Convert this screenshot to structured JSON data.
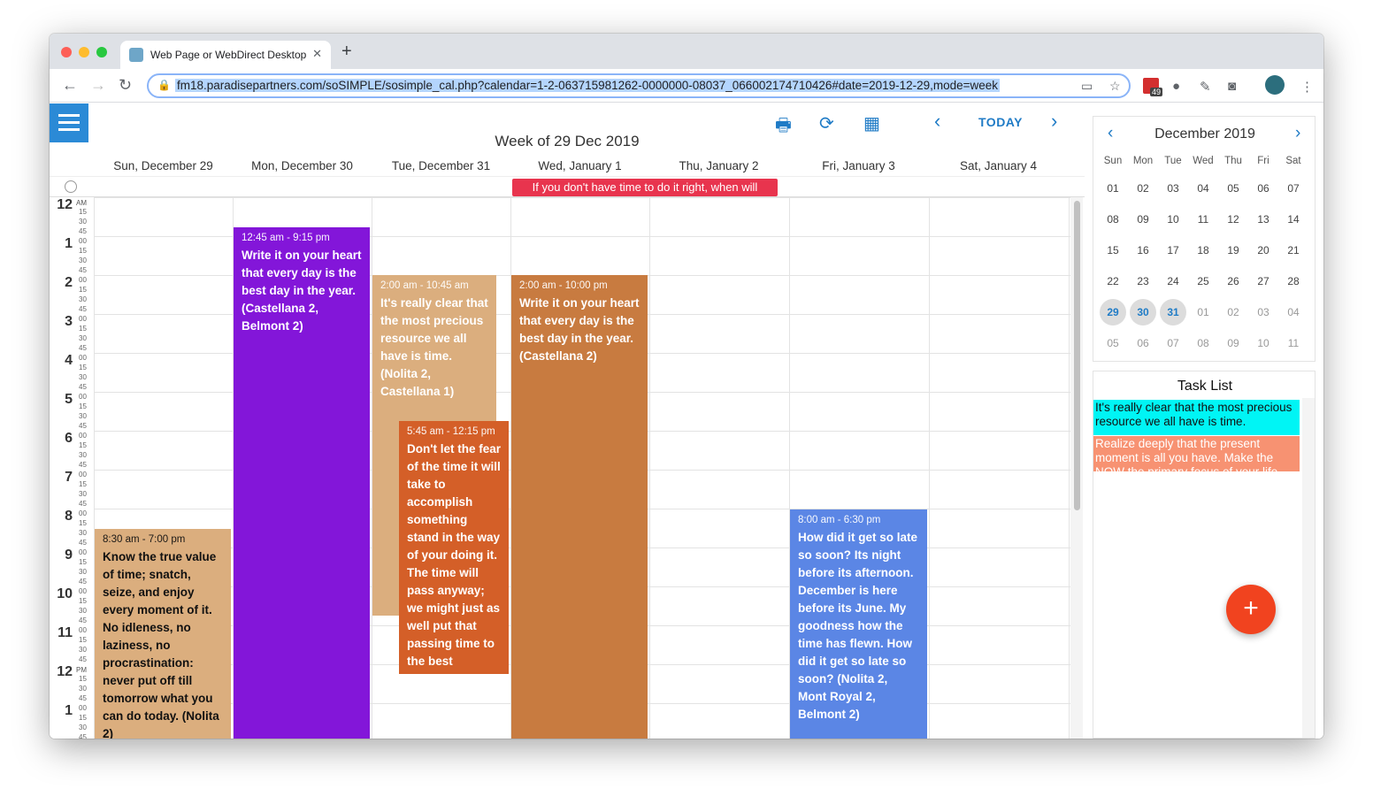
{
  "browser": {
    "tab_title": "Web Page or WebDirect Desktop",
    "url": "fm18.paradisepartners.com/soSIMPLE/sosimple_cal.php?calendar=1-2-063715981262-0000000-08037_066002174710426#date=2019-12-29,mode=week",
    "ext_badge": "49"
  },
  "calendar": {
    "week_title": "Week of 29 Dec 2019",
    "today_label": "TODAY",
    "days": [
      "Sun, December 29",
      "Mon, December 30",
      "Tue, December 31",
      "Wed, January 1",
      "Thu, January 2",
      "Fri, January 3",
      "Sat, January 4"
    ],
    "allday_banner": "If you don't have time to do it right, when will",
    "hours": [
      "12",
      "1",
      "2",
      "3",
      "4",
      "5",
      "6",
      "7",
      "8",
      "9",
      "10",
      "11",
      "12",
      "1"
    ],
    "am_label": "AM",
    "pm_label": "PM",
    "quarter_labels": [
      "00",
      "15",
      "30",
      "45"
    ],
    "events": [
      {
        "time": "12:45 am - 9:15 pm",
        "text": "Write it on your heart that every day is the best day in the year. (Castellana 2, Belmont 2)",
        "color": "#8316d9"
      },
      {
        "time": "2:00 am - 10:45 am",
        "text": "It's really clear that the most precious resource we all have is time. (Nolita 2, Castellana 1)",
        "color": "#dbae7e"
      },
      {
        "time": "5:45 am - 12:15 pm",
        "text": "Don't let the fear of the time it will take to accomplish something stand in the way of your doing it. The time will pass anyway; we might just as well put that passing time to the best possible",
        "color": "#d45f28"
      },
      {
        "time": "2:00 am - 10:00 pm",
        "text": "Write it on your heart that every day is the best day in the year. (Castellana 2)",
        "color": "#c87b40"
      },
      {
        "time": "8:30 am - 7:00 pm",
        "text": "Know the true value of time; snatch, seize, and enjoy every moment of it. No idleness, no laziness, no procrastination: never put off till tomorrow what you can do today. (Nolita 2)",
        "color": "#dbae7e"
      },
      {
        "time": "8:00 am - 6:30 pm",
        "text": "How did it get so late so soon? Its night before its afternoon. December is here before its June. My goodness how the time has flewn. How did it get so late so soon? (Nolita 2, Mont Royal 2, Belmont 2)",
        "color": "#5b86e5"
      }
    ]
  },
  "mini_calendar": {
    "title": "December 2019",
    "weekdays": [
      "Sun",
      "Mon",
      "Tue",
      "Wed",
      "Thu",
      "Fri",
      "Sat"
    ],
    "weeks": [
      [
        "01",
        "02",
        "03",
        "04",
        "05",
        "06",
        "07"
      ],
      [
        "08",
        "09",
        "10",
        "11",
        "12",
        "13",
        "14"
      ],
      [
        "15",
        "16",
        "17",
        "18",
        "19",
        "20",
        "21"
      ],
      [
        "22",
        "23",
        "24",
        "25",
        "26",
        "27",
        "28"
      ],
      [
        "29",
        "30",
        "31",
        "01",
        "02",
        "03",
        "04"
      ],
      [
        "05",
        "06",
        "07",
        "08",
        "09",
        "10",
        "11"
      ]
    ]
  },
  "task_list": {
    "title": "Task List",
    "items": [
      {
        "text": "It's really clear that the most precious resource we all have is time.",
        "color": "#00f5f5"
      },
      {
        "text": "Realize deeply that the present moment is all you have. Make the NOW the primary focus of your life.",
        "color": "#f79272"
      }
    ]
  },
  "fab_label": "+"
}
